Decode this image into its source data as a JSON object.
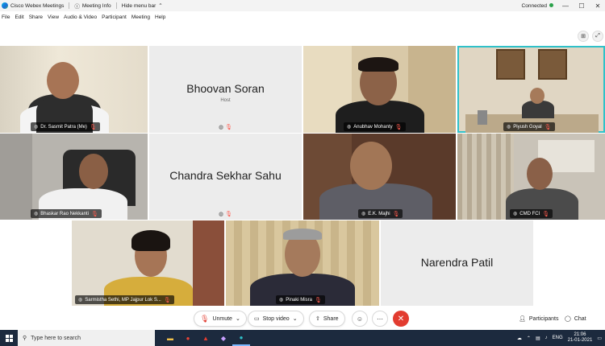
{
  "titlebar": {
    "app_title": "Cisco Webex Meetings",
    "meeting_info": "Meeting Info",
    "hide_menu_bar": "Hide menu bar",
    "status": "Connected"
  },
  "menu": [
    "File",
    "Edit",
    "Share",
    "View",
    "Audio & Video",
    "Participant",
    "Meeting",
    "Help"
  ],
  "tiles": {
    "sasmit": "Dr. Sasmit Patra (Me)",
    "bhoovan": "Bhoovan Soran",
    "bhoovan_role": "Host",
    "anubhav": "Anubhav Mohanty",
    "piyush": "Piyush Goyal",
    "bhaskar": "Bhaskar Rao Nekkanti",
    "chandra": "Chandra Sekhar Sahu",
    "majhi": "E.K. Majhi",
    "cmd": "CMD FCI",
    "sarmistha": "Sarmistha Sethi, MP Jajpur Lok S...",
    "pinaki": "Pinaki Misra",
    "narendra": "Narendra Patil"
  },
  "controls": {
    "unmute": "Unmute",
    "stop_video": "Stop video",
    "share": "Share",
    "participants": "Participants",
    "chat": "Chat"
  },
  "taskbar": {
    "search_placeholder": "Type here to search",
    "lang": "ENG",
    "time": "21:06",
    "date": "21-01-2021"
  },
  "colors": {
    "active_speaker": "#2fc1c9",
    "end_button": "#e23c30",
    "taskbar": "#1c2a3e"
  }
}
